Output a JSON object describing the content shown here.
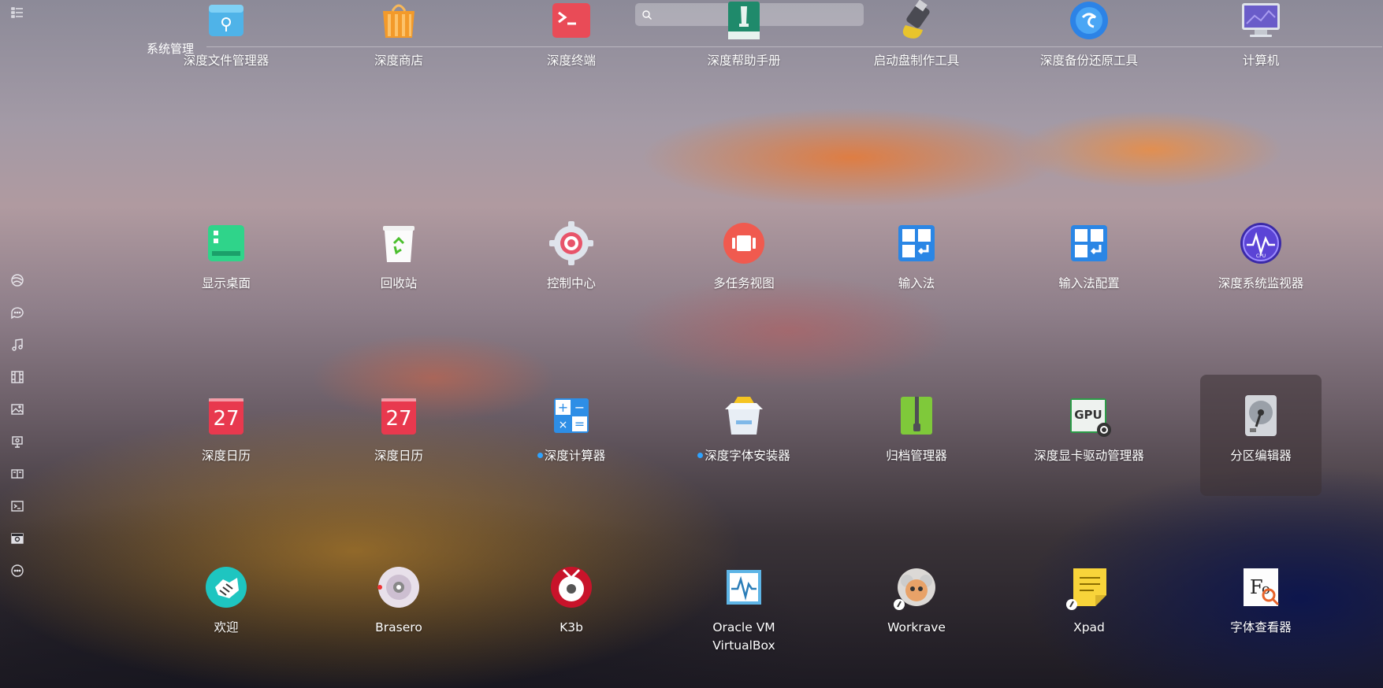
{
  "search": {
    "placeholder": ""
  },
  "category": {
    "title": "系统管理"
  },
  "sidebar": {
    "items": [
      {
        "name": "list-view-icon"
      },
      {
        "name": "internet-icon"
      },
      {
        "name": "chat-icon"
      },
      {
        "name": "music-icon"
      },
      {
        "name": "video-icon"
      },
      {
        "name": "image-icon"
      },
      {
        "name": "game-icon"
      },
      {
        "name": "office-icon"
      },
      {
        "name": "terminal-icon"
      },
      {
        "name": "system-icon"
      },
      {
        "name": "more-icon"
      }
    ]
  },
  "apps": [
    {
      "label": "深度文件管理器",
      "icon": "file-manager-icon",
      "new": false
    },
    {
      "label": "深度商店",
      "icon": "app-store-icon",
      "new": false
    },
    {
      "label": "深度终端",
      "icon": "terminal-app-icon",
      "new": false
    },
    {
      "label": "深度帮助手册",
      "icon": "help-manual-icon",
      "new": false
    },
    {
      "label": "启动盘制作工具",
      "icon": "boot-maker-icon",
      "new": false
    },
    {
      "label": "深度备份还原工具",
      "icon": "backup-restore-icon",
      "new": false
    },
    {
      "label": "计算机",
      "icon": "computer-icon",
      "new": false
    },
    {
      "label": "显示桌面",
      "icon": "show-desktop-icon",
      "new": false
    },
    {
      "label": "回收站",
      "icon": "trash-icon",
      "new": false
    },
    {
      "label": "控制中心",
      "icon": "control-center-icon",
      "new": false
    },
    {
      "label": "多任务视图",
      "icon": "multitask-view-icon",
      "new": false
    },
    {
      "label": "输入法",
      "icon": "input-method-icon",
      "new": false
    },
    {
      "label": "输入法配置",
      "icon": "input-method-config-icon",
      "new": false
    },
    {
      "label": "深度系统监视器",
      "icon": "system-monitor-icon",
      "new": false
    },
    {
      "label": "深度日历",
      "icon": "calendar-icon",
      "new": false,
      "day": "27"
    },
    {
      "label": "深度日历",
      "icon": "calendar-icon",
      "new": false,
      "day": "27"
    },
    {
      "label": "深度计算器",
      "icon": "calculator-icon",
      "new": true
    },
    {
      "label": "深度字体安装器",
      "icon": "font-installer-icon",
      "new": true
    },
    {
      "label": "归档管理器",
      "icon": "archive-manager-icon",
      "new": false
    },
    {
      "label": "深度显卡驱动管理器",
      "icon": "gpu-driver-icon",
      "new": false,
      "badge": "GPU"
    },
    {
      "label": "分区编辑器",
      "icon": "partition-editor-icon",
      "new": false,
      "selected": true
    },
    {
      "label": "欢迎",
      "icon": "welcome-icon",
      "new": false
    },
    {
      "label": "Brasero",
      "icon": "brasero-icon",
      "new": false
    },
    {
      "label": "K3b",
      "icon": "k3b-icon",
      "new": false
    },
    {
      "label": "Oracle VM VirtualBox",
      "icon": "virtualbox-icon",
      "new": false
    },
    {
      "label": "Workrave",
      "icon": "workrave-icon",
      "new": false
    },
    {
      "label": "Xpad",
      "icon": "xpad-icon",
      "new": false
    },
    {
      "label": "字体查看器",
      "icon": "font-viewer-icon",
      "new": false,
      "glyph": "Fo"
    }
  ],
  "colors": {
    "accent": "#2ea3ff",
    "selected_bg": "#3c3234"
  }
}
